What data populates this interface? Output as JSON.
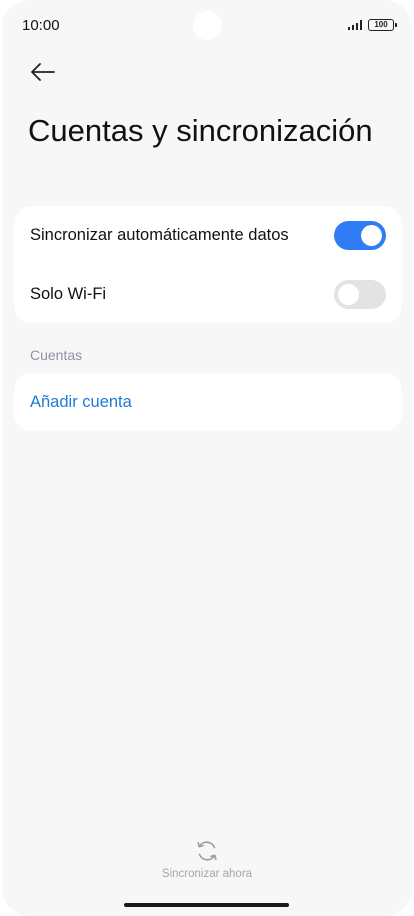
{
  "status_bar": {
    "time": "10:00",
    "battery": "100",
    "icons": [
      "signal-icon",
      "battery-icon"
    ]
  },
  "header": {
    "back_icon": "arrow-left-icon",
    "title": "Cuentas y sincronización"
  },
  "sync_settings": {
    "auto_sync": {
      "label": "Sincronizar automáticamente datos",
      "enabled": true
    },
    "wifi_only": {
      "label": "Solo Wi-Fi",
      "enabled": false
    }
  },
  "accounts": {
    "section_title": "Cuentas",
    "add_account_label": "Añadir cuenta"
  },
  "footer": {
    "sync_now_icon": "refresh-icon",
    "sync_now_label": "Sincronizar ahora"
  },
  "colors": {
    "accent": "#2f7cf6",
    "link": "#1f7ad6",
    "section_header": "#8c93a3",
    "background": "#f7f7f7"
  }
}
